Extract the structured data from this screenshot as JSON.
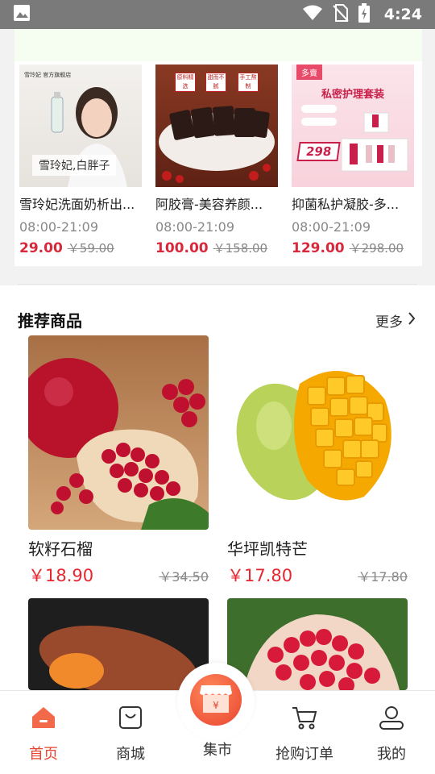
{
  "status_bar": {
    "time": "4:24"
  },
  "flash_sale": {
    "items": [
      {
        "name": "雪玲妃洗面奶析出...",
        "time": "08:00-21:09",
        "price": "29.00",
        "old_price": "￥59.00",
        "img_caption": "雪玲妃,白胖子",
        "brand": "雪玲妃 官方旗舰店"
      },
      {
        "name": "阿胶膏-美容养颜...",
        "time": "08:00-21:09",
        "price": "100.00",
        "old_price": "￥158.00",
        "tags": [
          "原料精选",
          "甜而不腻",
          "手工熬制"
        ]
      },
      {
        "name": "抑菌私护凝胶-多...",
        "time": "08:00-21:09",
        "price": "129.00",
        "old_price": "￥298.00",
        "badge": "多賣",
        "banner": "私密护理套装",
        "price_tag": "298"
      }
    ]
  },
  "recommend": {
    "title": "推荐商品",
    "more": "更多",
    "products": [
      {
        "name": "软籽石榴",
        "price": "￥18.90",
        "old_price": "￥34.50"
      },
      {
        "name": "华坪凯特芒",
        "price": "￥17.80",
        "old_price": "￥17.80"
      }
    ]
  },
  "nav": {
    "items": [
      {
        "label": "首页",
        "icon": "home-icon",
        "active": true
      },
      {
        "label": "商城",
        "icon": "shopping-bag-icon"
      },
      {
        "label": "集市",
        "icon": "market-icon"
      },
      {
        "label": "抢购订单",
        "icon": "cart-icon"
      },
      {
        "label": "我的",
        "icon": "user-icon"
      }
    ]
  },
  "colors": {
    "accent": "#e8432e",
    "price_red": "#d8283c"
  }
}
